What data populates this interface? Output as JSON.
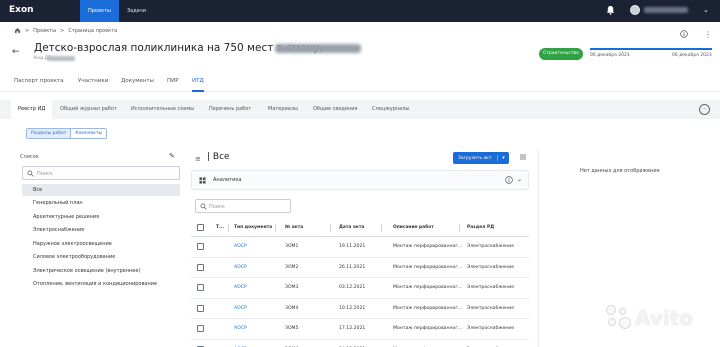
{
  "app": {
    "logo": "Exon"
  },
  "topnav": {
    "items": [
      {
        "label": "Проекты"
      },
      {
        "label": "Задачи"
      }
    ]
  },
  "breadcrumb": {
    "items": [
      "Проекты",
      "Страница проекта"
    ],
    "separator": ">"
  },
  "page": {
    "title": "Детско-взрослая поликлиника на 750 мест в смену,",
    "code_label": "Код ДС",
    "status": "Строительство",
    "date_start": "06 декабря 2021",
    "date_end": "06 декабря 2023",
    "progress": 1.0
  },
  "main_tabs": [
    {
      "label": "Паспорт проекта"
    },
    {
      "label": "Участники"
    },
    {
      "label": "Документы"
    },
    {
      "label": "ПИР"
    },
    {
      "label": "ИТД"
    }
  ],
  "sub_tabs": [
    {
      "label": "Реестр ИД"
    },
    {
      "label": "Общий журнал работ"
    },
    {
      "label": "Исполнительные схемы"
    },
    {
      "label": "Перечень работ"
    },
    {
      "label": "Материалы"
    },
    {
      "label": "Общие сведения"
    },
    {
      "label": "Спецжурналы"
    }
  ],
  "toggle": {
    "sections": "Разделы работ",
    "complects": "Комплекты"
  },
  "left_panel": {
    "title": "Список",
    "search_placeholder": "Поиск",
    "items": [
      "Все",
      "Генеральный план",
      "Архитектурные решения",
      "Электроснабжение",
      "Наружное электроосвещение",
      "Силовое электрооборудование",
      "Электрическое освещение (внутреннее)",
      "Отопление, вентиляция и кондиционирование"
    ]
  },
  "center": {
    "title": "Все",
    "upload_label": "Загрузить акт",
    "analytics_label": "Аналитика",
    "search_placeholder": "Поиск",
    "table": {
      "headers": [
        "Т...",
        "Тип документа",
        "№ акта",
        "Дата акта",
        "Описание работ",
        "Раздел РД"
      ],
      "rows": [
        [
          "АОСР",
          "ЗОМ1",
          "19.11.2021",
          "Монтаж перфорированног...",
          "Электроснабжение"
        ],
        [
          "АОСР",
          "ЗОМ2",
          "26.11.2021",
          "Монтаж перфорированног...",
          "Электроснабжение"
        ],
        [
          "АОСР",
          "ЗОМ3",
          "03.12.2021",
          "Монтаж перфорированног...",
          "Электроснабжение"
        ],
        [
          "АОСР",
          "ЗОМ4",
          "10.12.2021",
          "Монтаж перфорированног...",
          "Электроснабжение"
        ],
        [
          "АОСР",
          "ЗОМ5",
          "17.12.2021",
          "Монтаж перфорированног...",
          "Электроснабжение"
        ],
        [
          "АОСР",
          "ЗОМ6",
          "24.12.2021",
          "Монтаж перфорированног...",
          "Электроснабжение"
        ]
      ]
    }
  },
  "right_panel": {
    "no_data": "Нет данных для отображения"
  },
  "watermark": {
    "text": "Avito"
  },
  "colors": {
    "primary": "#1a6dd8",
    "topbar": "#1a2233",
    "status": "#31a244"
  }
}
